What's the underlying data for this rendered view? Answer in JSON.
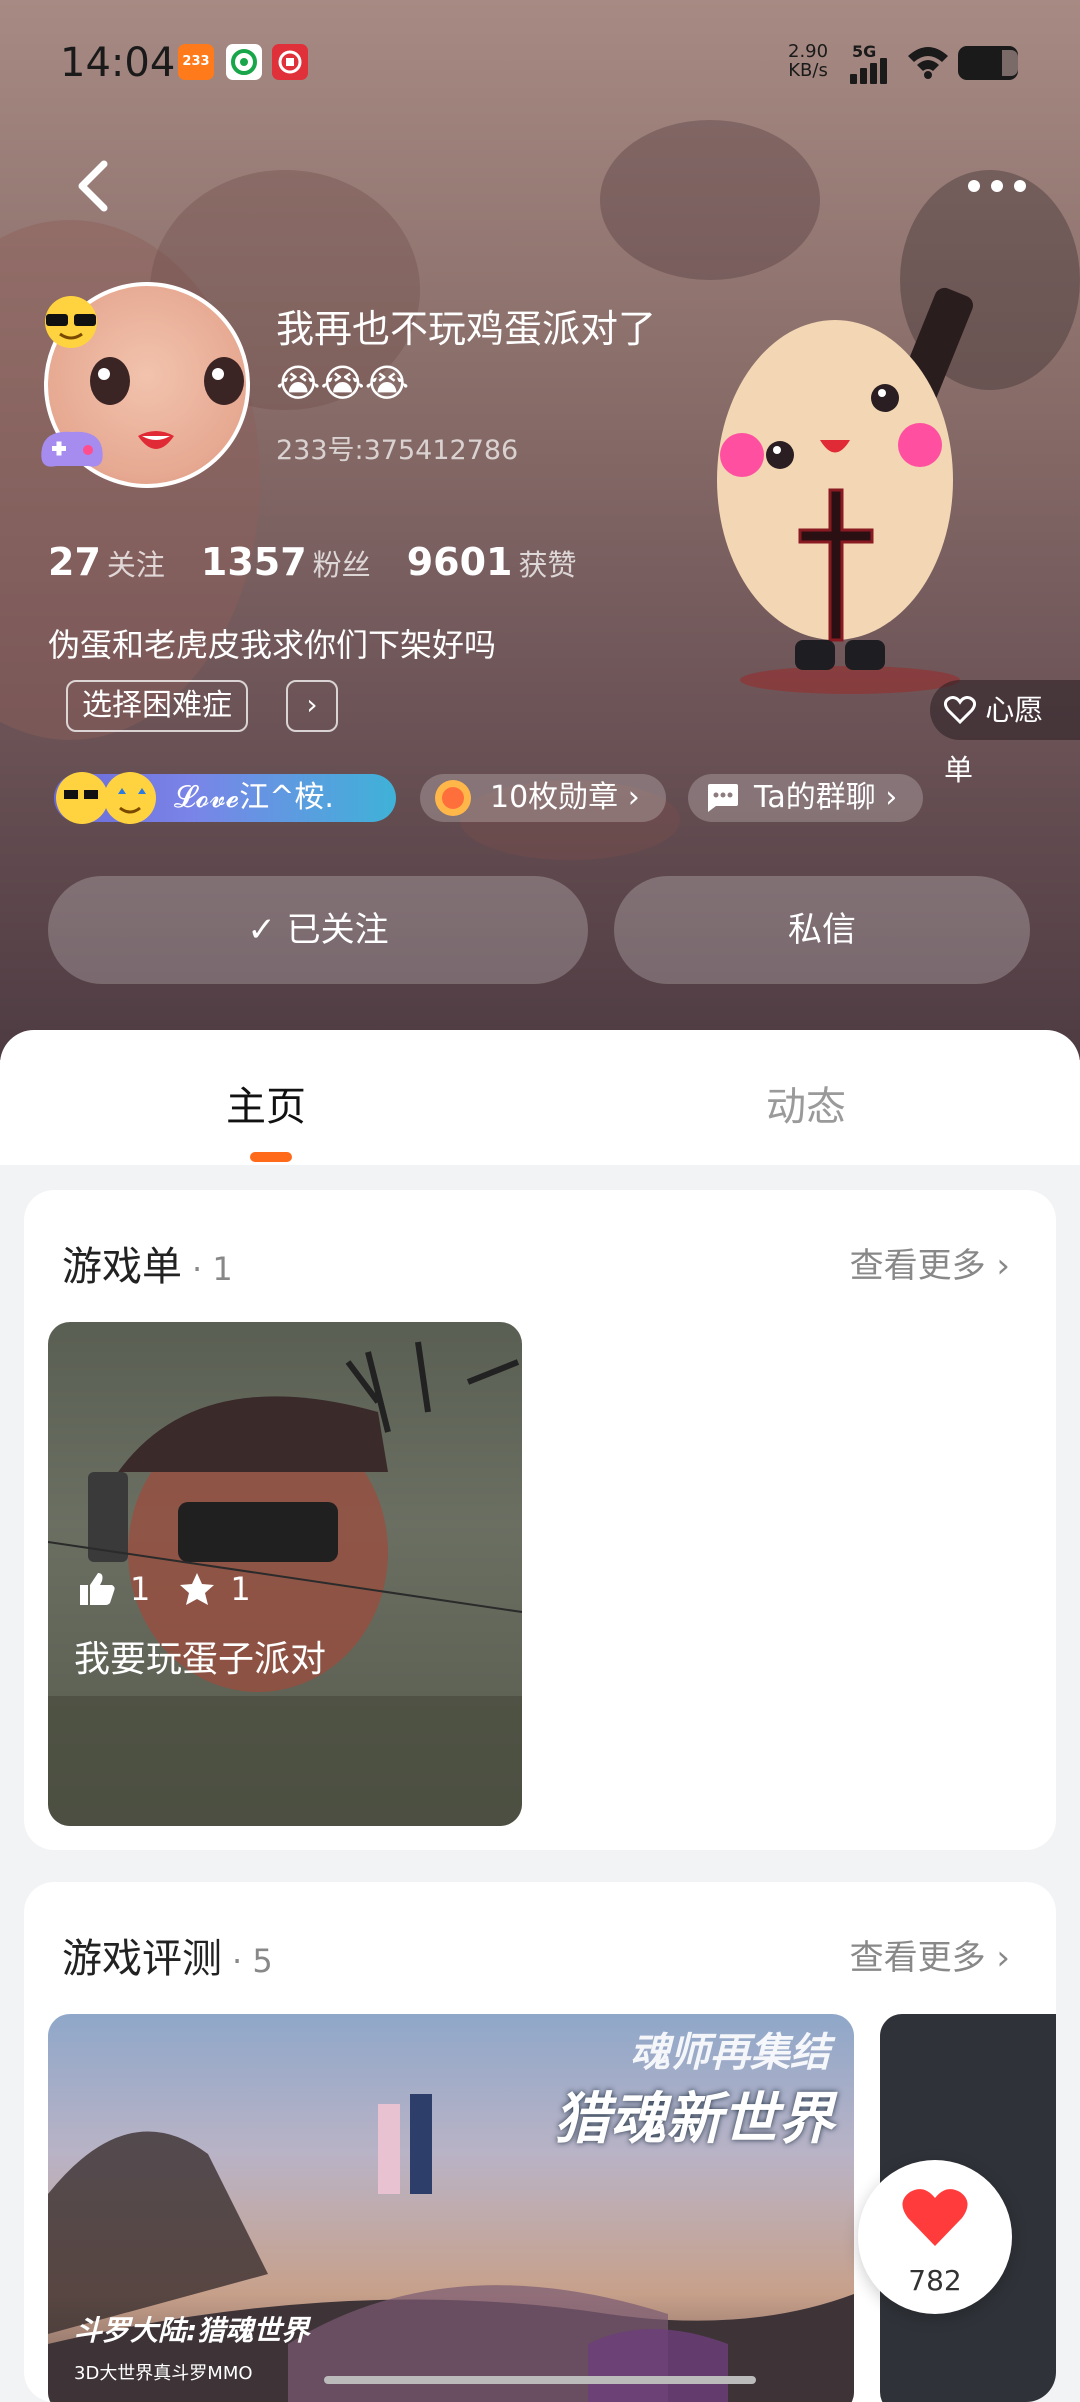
{
  "status_bar": {
    "time": "14:04",
    "app_badge": "233",
    "net_speed_value": "2.90",
    "net_speed_unit": "KB/s",
    "network": "5G"
  },
  "profile": {
    "nickname": "我再也不玩鸡蛋派对了😭😭😭",
    "uid": "233号:375412786",
    "stats": [
      {
        "value": "27",
        "label": "关注"
      },
      {
        "value": "1357",
        "label": "粉丝"
      },
      {
        "value": "9601",
        "label": "获赞"
      }
    ],
    "bio": "伪蛋和老虎皮我求你们下架好吗",
    "tag": "选择困难症",
    "tag_more": "›",
    "wishlist_label": "心愿单",
    "chips": {
      "love": "𝓛𝓸𝓿𝓮江^桉.",
      "medals": "10枚勋章",
      "group_chat": "Ta的群聊"
    },
    "follow_button": "已关注",
    "message_button": "私信"
  },
  "tabs": [
    {
      "label": "主页",
      "active": true
    },
    {
      "label": "动态",
      "active": false
    }
  ],
  "game_lists": {
    "title": "游戏单",
    "count": "· 1",
    "more": "查看更多",
    "items": [
      {
        "likes": "1",
        "stars": "1",
        "title": "我要玩蛋子派对"
      }
    ]
  },
  "game_reviews": {
    "title": "游戏评测",
    "count": "· 5",
    "more": "查看更多",
    "items": [
      {
        "banner_title": "猎魂新世界",
        "banner_subtitle": "魂师再集结",
        "logo": "斗罗大陆:猎魂世界",
        "caption": "3D大世界真斗罗MMO"
      }
    ]
  },
  "like_fab": {
    "count": "782"
  },
  "colors": {
    "accent": "#ff6a1a",
    "heart": "#ff3b3b"
  }
}
